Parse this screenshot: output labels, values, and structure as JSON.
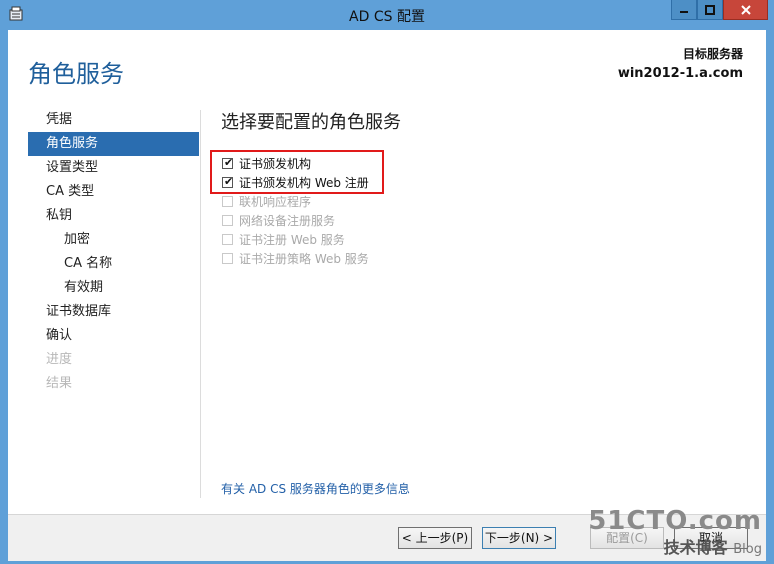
{
  "window": {
    "title": "AD CS 配置"
  },
  "header": {
    "page_title": "角色服务",
    "target_label": "目标服务器",
    "target_server": "win2012-1.a.com"
  },
  "nav": {
    "items": [
      {
        "label": "凭据",
        "state": "normal",
        "indent": 0
      },
      {
        "label": "角色服务",
        "state": "active",
        "indent": 0
      },
      {
        "label": "设置类型",
        "state": "normal",
        "indent": 0
      },
      {
        "label": "CA 类型",
        "state": "normal",
        "indent": 0
      },
      {
        "label": "私钥",
        "state": "normal",
        "indent": 0
      },
      {
        "label": "加密",
        "state": "normal",
        "indent": 1
      },
      {
        "label": "CA 名称",
        "state": "normal",
        "indent": 1
      },
      {
        "label": "有效期",
        "state": "normal",
        "indent": 1
      },
      {
        "label": "证书数据库",
        "state": "normal",
        "indent": 0
      },
      {
        "label": "确认",
        "state": "normal",
        "indent": 0
      },
      {
        "label": "进度",
        "state": "disabled",
        "indent": 0
      },
      {
        "label": "结果",
        "state": "disabled",
        "indent": 0
      }
    ]
  },
  "main": {
    "title": "选择要配置的角色服务",
    "options": [
      {
        "label": "证书颁发机构",
        "checked": true,
        "enabled": true
      },
      {
        "label": "证书颁发机构 Web 注册",
        "checked": true,
        "enabled": true
      },
      {
        "label": "联机响应程序",
        "checked": false,
        "enabled": false
      },
      {
        "label": "网络设备注册服务",
        "checked": false,
        "enabled": false
      },
      {
        "label": "证书注册 Web 服务",
        "checked": false,
        "enabled": false
      },
      {
        "label": "证书注册策略 Web 服务",
        "checked": false,
        "enabled": false
      }
    ],
    "more_link": "有关 AD CS 服务器角色的更多信息"
  },
  "footer": {
    "prev": "< 上一步(P)",
    "next": "下一步(N) >",
    "configure": "配置(C)",
    "cancel": "取消"
  },
  "watermark": {
    "site": "51CTO.com",
    "sub": "技术博客",
    "blog": "Blog"
  },
  "colors": {
    "accent": "#2a6db0",
    "title_blue": "#1f5f9b",
    "highlight_red": "#e11a1a"
  }
}
